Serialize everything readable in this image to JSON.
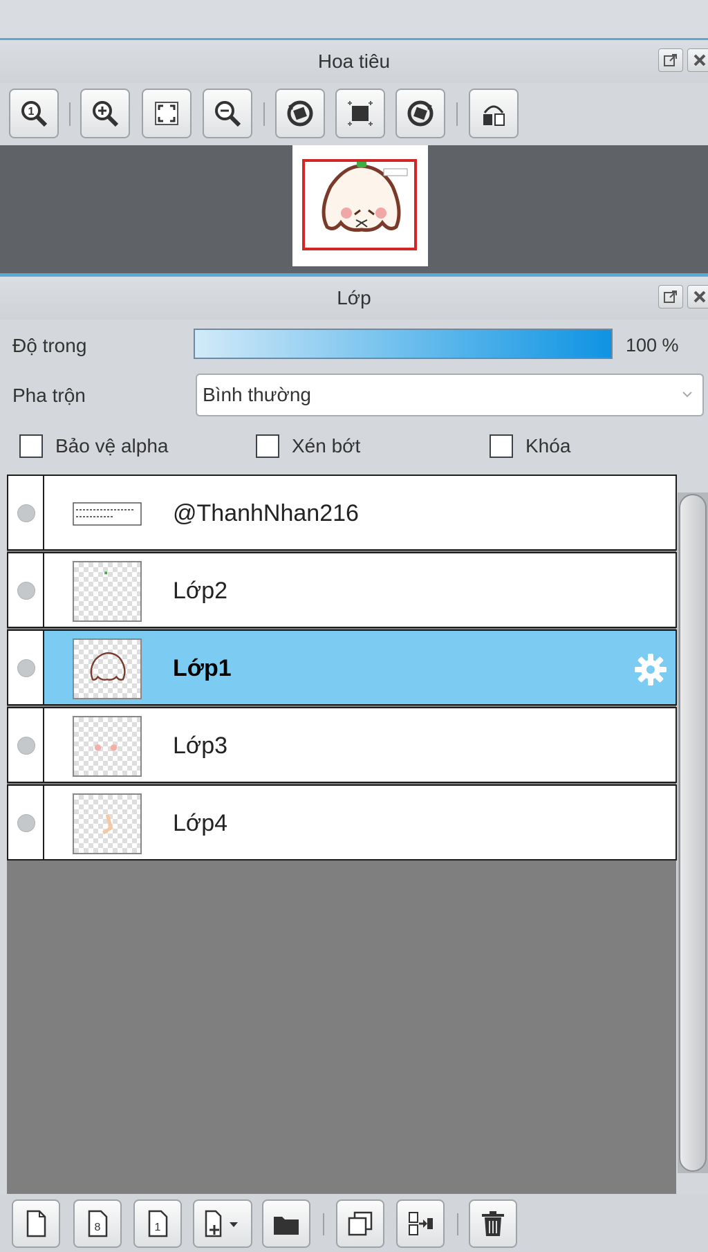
{
  "navigator": {
    "title": "Hoa tiêu",
    "tools": [
      "zoom-actual-icon",
      "zoom-in-icon",
      "fit-to-window-icon",
      "zoom-out-icon",
      "rotate-left-icon",
      "reset-view-icon",
      "rotate-right-icon",
      "flip-horizontal-icon"
    ]
  },
  "layers_panel": {
    "title": "Lớp",
    "opacity_label": "Độ trong",
    "opacity_value": "100 %",
    "opacity_fraction": 1.0,
    "blend_label": "Pha trộn",
    "blend_value": "Bình thường",
    "checks": {
      "protect_alpha": "Bảo vệ alpha",
      "clipping": "Xén bớt",
      "lock": "Khóa"
    },
    "layers": [
      {
        "name": "@ThanhNhan216",
        "selected": false
      },
      {
        "name": "Lớp2",
        "selected": false
      },
      {
        "name": "Lớp1",
        "selected": true
      },
      {
        "name": "Lớp3",
        "selected": false
      },
      {
        "name": "Lớp4",
        "selected": false
      }
    ]
  },
  "bottom_toolbar": {
    "buttons": [
      "new-layer-icon",
      "new-8bit-layer-icon",
      "new-1bit-layer-icon",
      "add-layer-dropdown-icon",
      "new-folder-icon",
      "duplicate-layer-icon",
      "merge-down-icon",
      "delete-layer-icon"
    ]
  },
  "colors": {
    "accent_line": "#5aa8d8",
    "selected_row": "#7ccbf3",
    "nav_frame": "#d32626"
  }
}
